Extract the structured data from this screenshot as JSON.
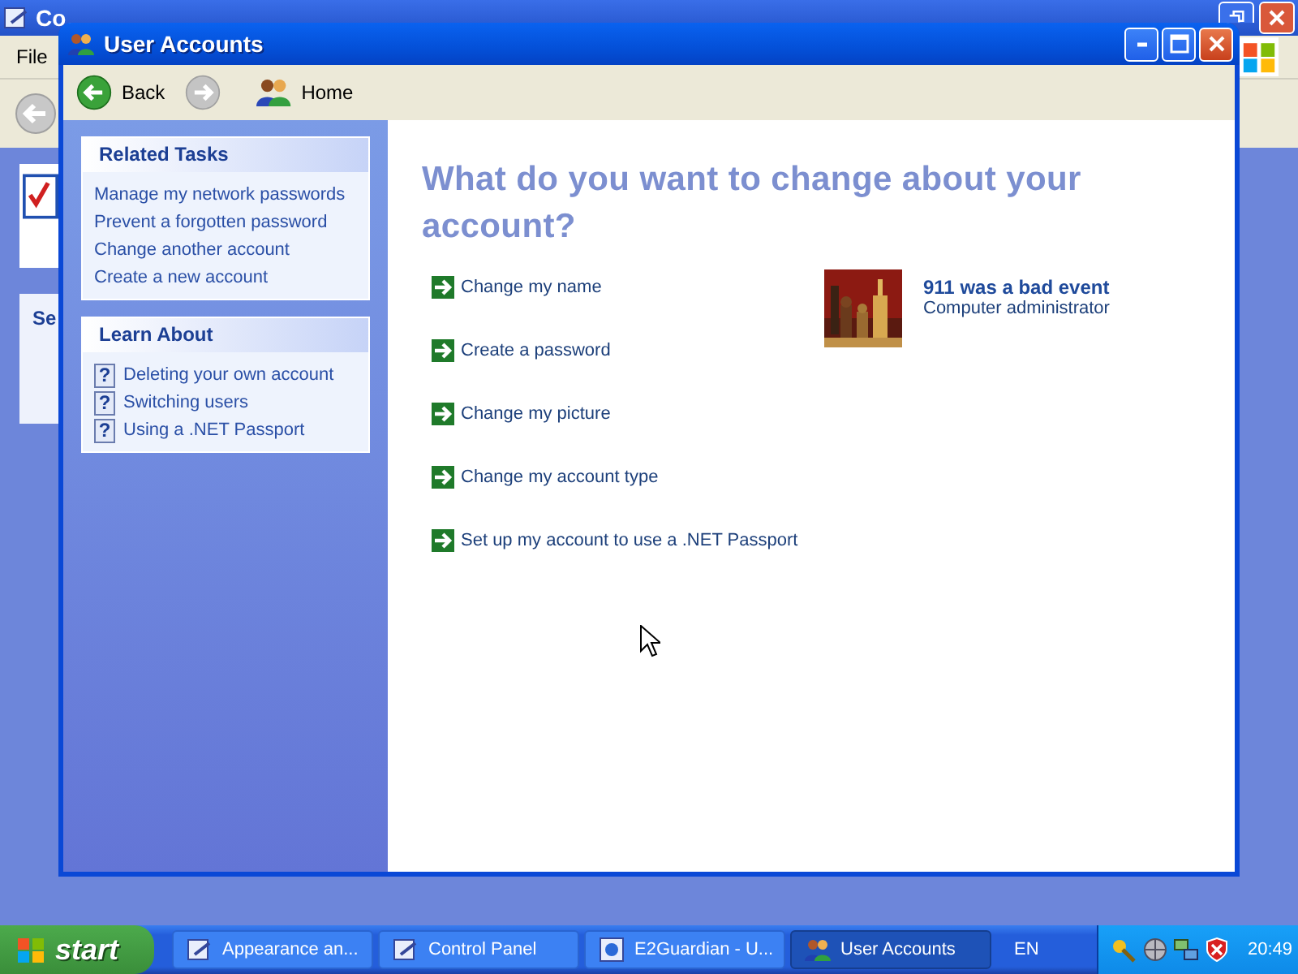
{
  "background_window": {
    "title": "Co",
    "menu": [
      "File"
    ],
    "panel_heading": "Se"
  },
  "window": {
    "title": "User Accounts",
    "toolbar": [
      {
        "kind": "back",
        "label": "Back",
        "disabled": false
      },
      {
        "kind": "forward",
        "disabled": true
      },
      {
        "kind": "home",
        "label": "Home",
        "disabled": false
      }
    ]
  },
  "sidebar": {
    "panels": [
      {
        "kind": "tasks",
        "title": "Related Tasks",
        "items": [
          "Manage my network passwords",
          "Prevent a forgotten password",
          "Change another account",
          "Create a new account"
        ]
      },
      {
        "kind": "learn",
        "title": "Learn About",
        "items": [
          {
            "icon": "?",
            "label": "Deleting your own account"
          },
          {
            "icon": "?",
            "label": "Switching users"
          },
          {
            "icon": "?",
            "label": "Using a .NET Passport"
          }
        ]
      }
    ]
  },
  "main": {
    "heading": "What do you want to change about your account?",
    "tasks": [
      "Change my name",
      "Create a password",
      "Change my picture",
      "Change my account type",
      "Set up my account to use a .NET Passport"
    ],
    "account": {
      "name": "911 was a bad event",
      "type": "Computer administrator"
    }
  },
  "taskbar": {
    "start": "start",
    "tasks": [
      {
        "kind": "folder",
        "label": "Appearance an...",
        "selected": false
      },
      {
        "kind": "folder",
        "label": "Control Panel",
        "selected": false
      },
      {
        "kind": "browser",
        "label": "E2Guardian - U...",
        "selected": false
      },
      {
        "kind": "users",
        "label": "User Accounts",
        "selected": true
      }
    ],
    "language": "EN",
    "clock": "20:49"
  }
}
